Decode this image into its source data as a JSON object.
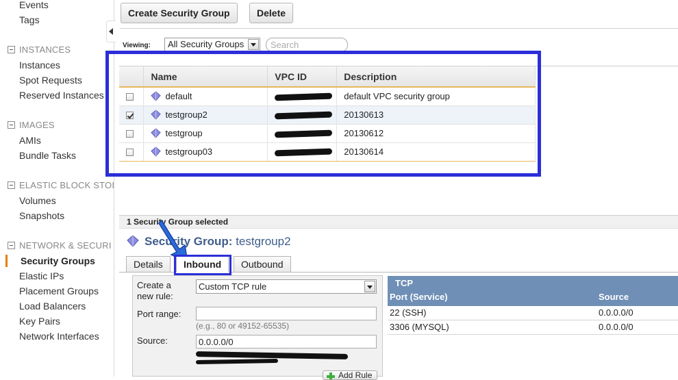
{
  "sidebar": {
    "top_items": [
      "Events",
      "Tags"
    ],
    "sections": [
      {
        "title": "INSTANCES",
        "items": [
          "Instances",
          "Spot Requests",
          "Reserved Instances"
        ]
      },
      {
        "title": "IMAGES",
        "items": [
          "AMIs",
          "Bundle Tasks"
        ]
      },
      {
        "title": "ELASTIC BLOCK STOI",
        "items": [
          "Volumes",
          "Snapshots"
        ]
      },
      {
        "title": "NETWORK & SECURI",
        "items": [
          "Security Groups",
          "Elastic IPs",
          "Placement Groups",
          "Load Balancers",
          "Key Pairs",
          "Network Interfaces"
        ]
      }
    ],
    "active_item": "Security Groups"
  },
  "toolbar": {
    "create_label": "Create Security Group",
    "delete_label": "Delete"
  },
  "filter": {
    "viewing_label": "Viewing:",
    "selected_option": "All Security Groups",
    "search_placeholder": "Search"
  },
  "grid": {
    "columns": [
      "Name",
      "VPC ID",
      "Description"
    ],
    "rows": [
      {
        "name": "default",
        "checked": false,
        "description": "default VPC security group"
      },
      {
        "name": "testgroup2",
        "checked": true,
        "description": "20130613"
      },
      {
        "name": "testgroup",
        "checked": false,
        "description": "20130612"
      },
      {
        "name": "testgroup03",
        "checked": false,
        "description": "20130614"
      }
    ]
  },
  "detail": {
    "selection_count": "1 Security Group selected",
    "title_prefix": "Security Group:",
    "title_name": "testgroup2",
    "tabs": [
      "Details",
      "Inbound",
      "Outbound"
    ],
    "active_tab": "Inbound"
  },
  "rule_form": {
    "create_label_line1": "Create a",
    "create_label_line2": "new rule:",
    "rule_type": "Custom TCP rule",
    "port_range_label": "Port range:",
    "port_range_value": "",
    "port_range_hint": "(e.g., 80 or 49152-65535)",
    "source_label": "Source:",
    "source_value": "0.0.0.0/0",
    "add_rule_label": "Add Rule"
  },
  "rules_table": {
    "protocol": "TCP",
    "columns": [
      "Port (Service)",
      "Source"
    ],
    "rows": [
      {
        "port": "22 (SSH)",
        "source": "0.0.0.0/0"
      },
      {
        "port": "3306 (MYSQL)",
        "source": "0.0.0.0/0"
      }
    ]
  },
  "colors": {
    "annotation_blue": "#2b2ed8",
    "rules_header": "#6f8fb6",
    "title_blue": "#3f5d8c",
    "active_marker": "#e67e00"
  }
}
